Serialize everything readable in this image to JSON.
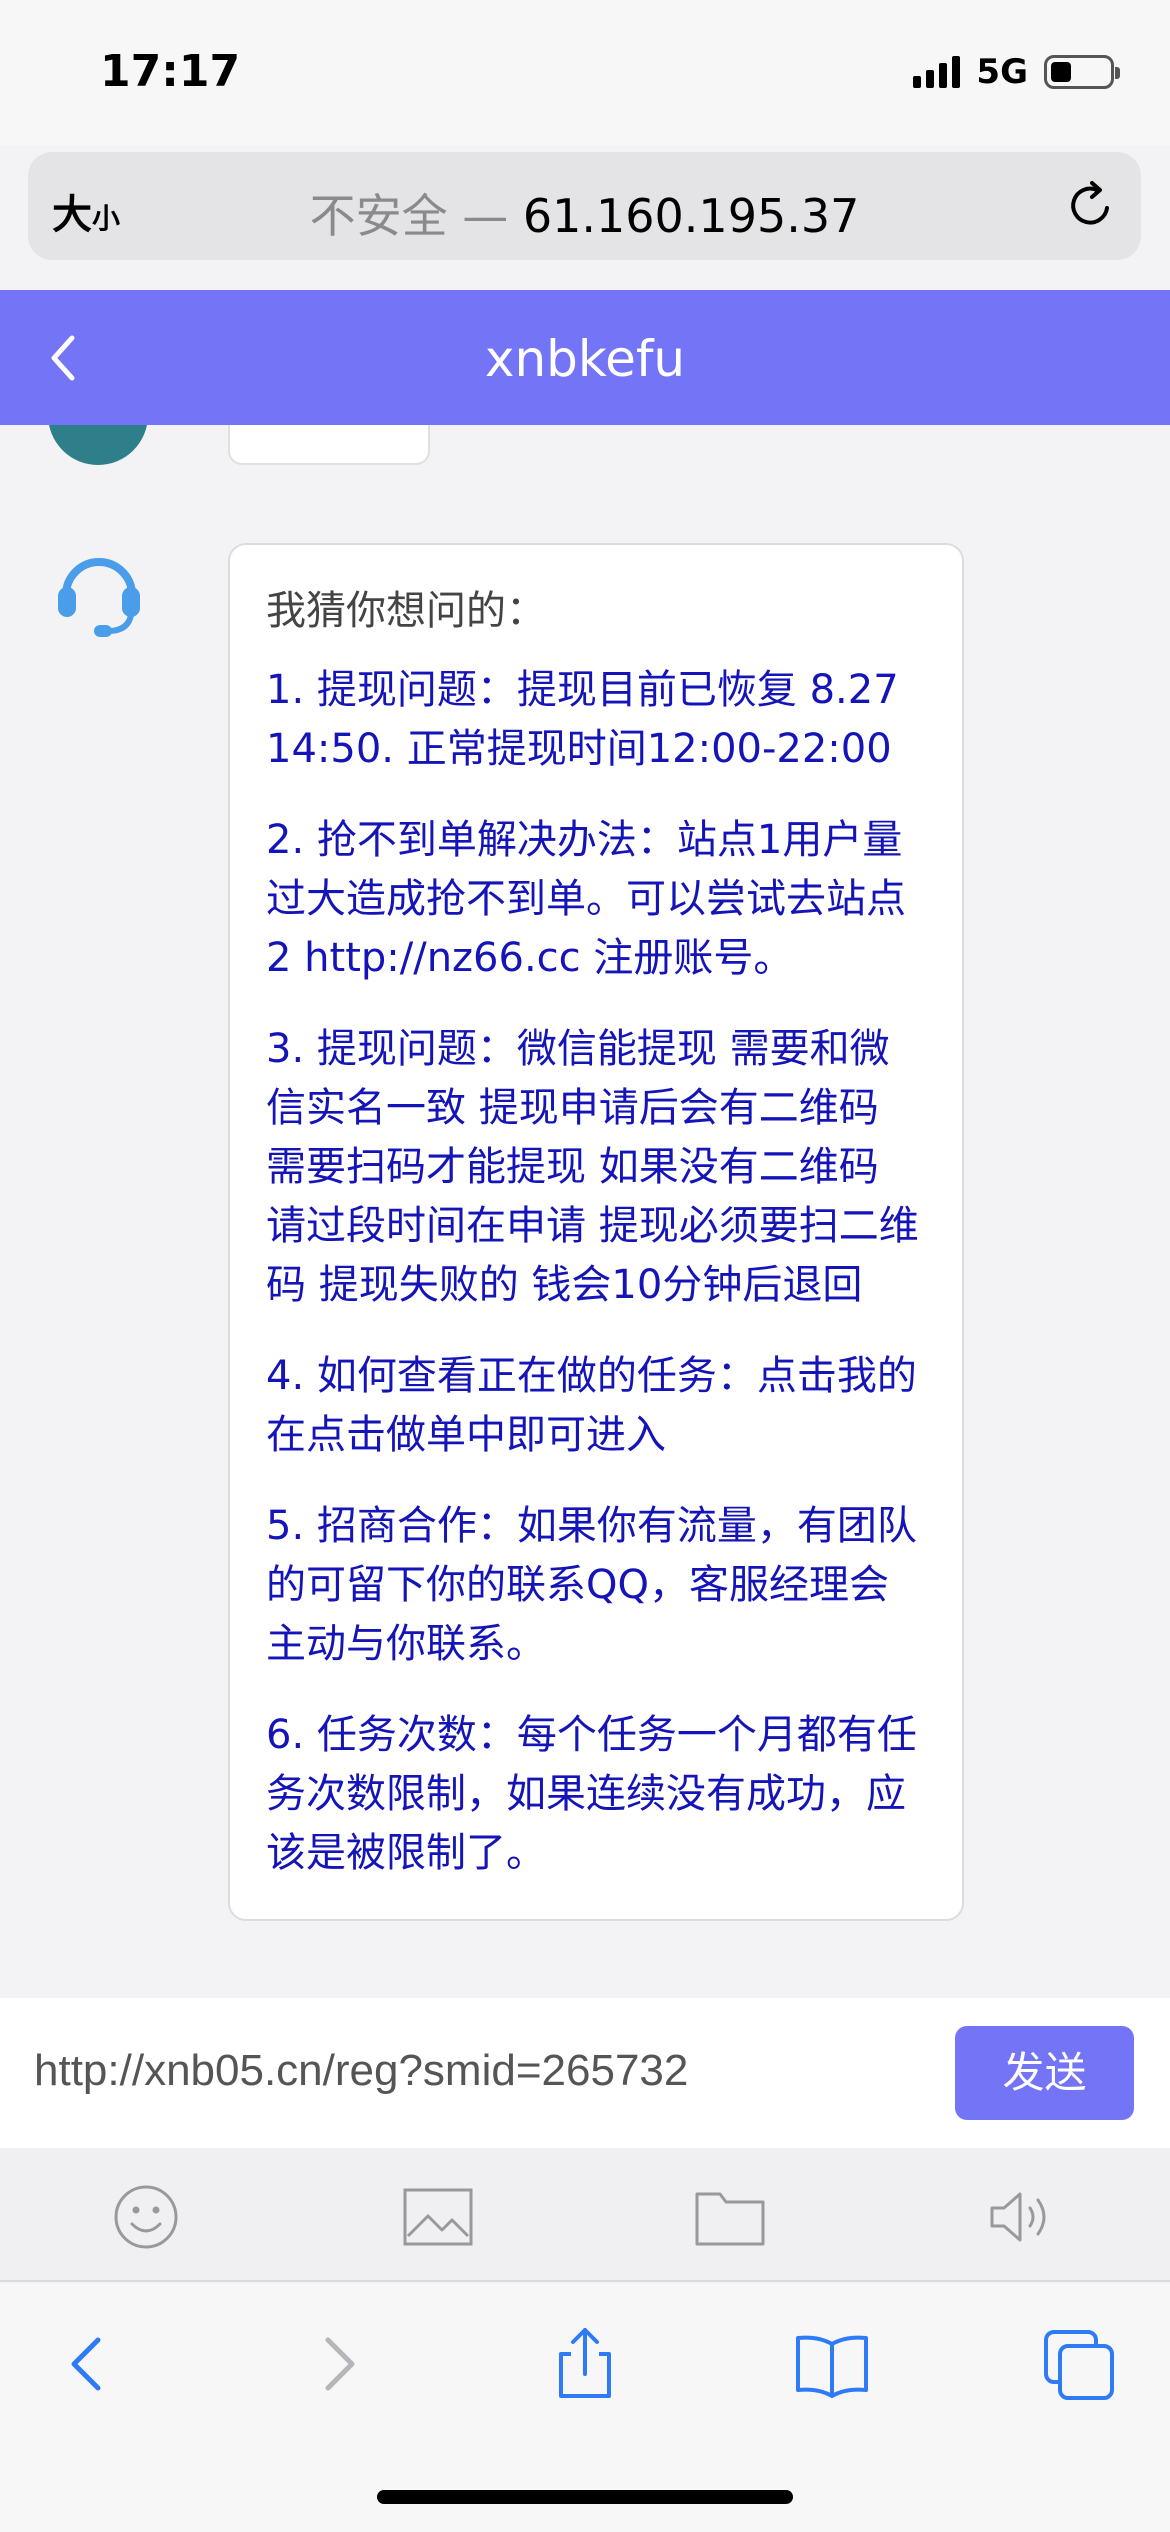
{
  "status_bar": {
    "time": "17:17",
    "network": "5G",
    "signal_bars": 4,
    "battery_level": 0.35
  },
  "address_bar": {
    "font_size_big": "大",
    "font_size_small": "小",
    "insecure_label": "不安全 — ",
    "url": "61.160.195.37"
  },
  "header": {
    "title": "xnbkefu"
  },
  "chat": {
    "intro": "我猜你想问的：",
    "items": [
      "1. 提现问题：提现目前已恢复 8.27 14:50. 正常提现时间12:00-22:00",
      "2. 抢不到单解决办法：站点1用户量过大造成抢不到单。可以尝试去站点2 http://nz66.cc 注册账号。",
      "3. 提现问题：微信能提现 需要和微信实名一致 提现申请后会有二维码 需要扫码才能提现 如果没有二维码 请过段时间在申请 提现必须要扫二维码 提现失败的 钱会10分钟后退回",
      "4. 如何查看正在做的任务：点击我的 在点击做单中即可进入",
      "5. 招商合作：如果你有流量，有团队的可留下你的联系QQ，客服经理会主动与你联系。",
      "6. 任务次数：每个任务一个月都有任务次数限制，如果连续没有成功，应该是被限制了。"
    ]
  },
  "composer": {
    "input_value": "http://xnb05.cn/reg?smid=265732",
    "send_label": "发送"
  },
  "toolbar": {
    "icons": [
      "emoji-icon",
      "image-icon",
      "folder-icon",
      "speaker-icon"
    ]
  },
  "safari_toolbar": {
    "icons": [
      "back-icon",
      "forward-icon",
      "share-icon",
      "bookmarks-icon",
      "tabs-icon"
    ]
  },
  "colors": {
    "accent": "#7474f6",
    "link_text": "#1414b8",
    "headset": "#4a9de8"
  }
}
